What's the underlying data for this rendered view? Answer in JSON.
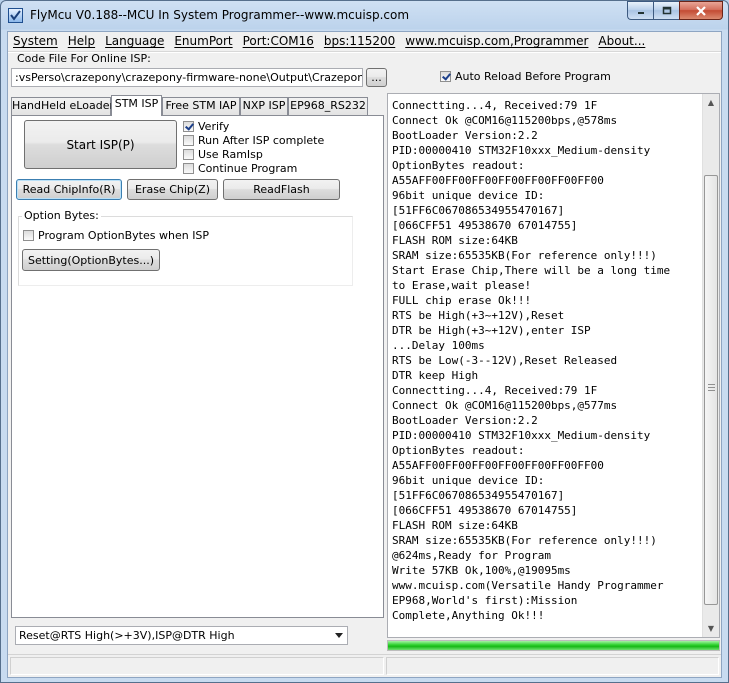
{
  "window": {
    "title": "FlyMcu V0.188--MCU In System Programmer--www.mcuisp.com",
    "min_icon": "minimize-icon",
    "max_icon": "maximize-icon",
    "close_icon": "close-icon"
  },
  "menu": {
    "items": [
      "System",
      "Help",
      "Language",
      "EnumPort",
      "Port:COM16",
      "bps:115200",
      "www.mcuisp.com,Programmer",
      "About..."
    ]
  },
  "code_file": {
    "label": "Code File For Online ISP:",
    "path": ":vsPerso\\crazepony\\crazepony-firmware-none\\Output\\Crazepony.hex",
    "browse_label": "...",
    "auto_reload_label": "Auto Reload Before Program",
    "auto_reload_checked": true
  },
  "tabs": [
    {
      "label": "HandHeld eLoader",
      "active": false
    },
    {
      "label": "STM ISP",
      "active": true
    },
    {
      "label": "Free STM IAP",
      "active": false
    },
    {
      "label": "NXP ISP",
      "active": false
    },
    {
      "label": "EP968_RS232",
      "active": false
    }
  ],
  "stm_isp": {
    "start_label": "Start ISP(P)",
    "options": [
      {
        "label": "Verify",
        "checked": true
      },
      {
        "label": "Run After ISP complete",
        "checked": false
      },
      {
        "label": "Use RamIsp",
        "checked": false
      },
      {
        "label": "Continue Program",
        "checked": false
      }
    ],
    "read_chipinfo_label": "Read ChipInfo(R)",
    "erase_chip_label": "Erase Chip(Z)",
    "read_flash_label": "ReadFlash",
    "option_bytes": {
      "title": "Option Bytes:",
      "program_label": "Program OptionBytes when ISP",
      "program_checked": false,
      "setting_label": "Setting(OptionBytes...)"
    }
  },
  "reset_mode": {
    "selected": "Reset@RTS High(>+3V),ISP@DTR High"
  },
  "log": {
    "lines": [
      "Connectting...4, Received:79 1F",
      "Connect Ok @COM16@115200bps,@578ms",
      "BootLoader Version:2.2",
      "PID:00000410  STM32F10xxx_Medium-density",
      "OptionBytes readout:",
      "A55AFF00FF00FF00FF00FF00FF00FF00",
      "96bit unique device ID:",
      "[51FF6C067086534955470167]",
      "[066CFF51 49538670 67014755]",
      "FLASH ROM size:64KB",
      "SRAM size:65535KB(For reference only!!!)",
      "Start Erase Chip,There will be a long time",
      "to Erase,wait please!",
      "FULL chip erase Ok!!!",
      "RTS be High(+3~+12V),Reset",
      "DTR be High(+3~+12V),enter ISP",
      "...Delay 100ms",
      "RTS be Low(-3--12V),Reset Released",
      "DTR keep High",
      "Connectting...4, Received:79 1F",
      "Connect Ok @COM16@115200bps,@577ms",
      "BootLoader Version:2.2",
      "PID:00000410  STM32F10xxx_Medium-density",
      "OptionBytes readout:",
      "A55AFF00FF00FF00FF00FF00FF00FF00",
      "96bit unique device ID:",
      "[51FF6C067086534955470167]",
      "[066CFF51 49538670 67014755]",
      "FLASH ROM size:64KB",
      "SRAM size:65535KB(For reference only!!!)",
      "@624ms,Ready for Program",
      "Write 57KB Ok,100%,@19095ms",
      "www.mcuisp.com(Versatile Handy Programmer",
      "EP968,World's first):Mission",
      "Complete,Anything Ok!!!"
    ]
  },
  "progress": {
    "fraction": 1.0,
    "color": "#2ecc2e"
  }
}
